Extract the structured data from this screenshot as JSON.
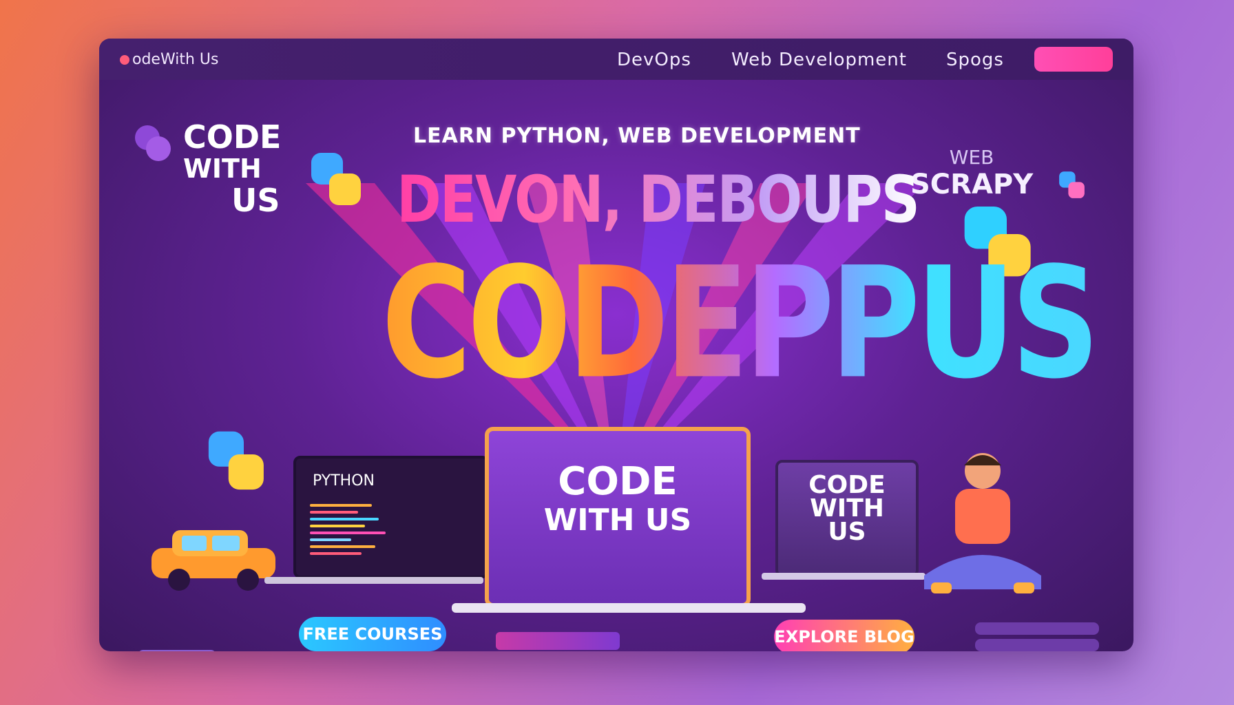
{
  "nav": {
    "brand": "odeWith Us",
    "links": [
      "DevOps",
      "Web Development",
      "Spogs"
    ],
    "cta_label": ""
  },
  "hero": {
    "tagline": "LEARN PYTHON, WEB DEVELOPMENT",
    "side_logo": [
      "CODE",
      "WITH",
      "US"
    ],
    "web_label": "WEB",
    "scrapy_label": "SCRAPY",
    "subhead": "DEVON, DEBOUPS",
    "big_title": "CODEPPUS",
    "left_laptop_title": "PYTHON",
    "mid_laptop": [
      "CODE",
      "WITH US"
    ],
    "right_laptop": [
      "CODE",
      "WITH",
      "US"
    ],
    "buttons": {
      "free_courses": "FREE COURSES",
      "explore_blog": "EXPLORE BLOG"
    }
  },
  "colors": {
    "accent_pink": "#ff3f9a",
    "accent_blue": "#2f8dff",
    "accent_orange": "#ffb03f",
    "bg_purple": "#5e2293"
  }
}
